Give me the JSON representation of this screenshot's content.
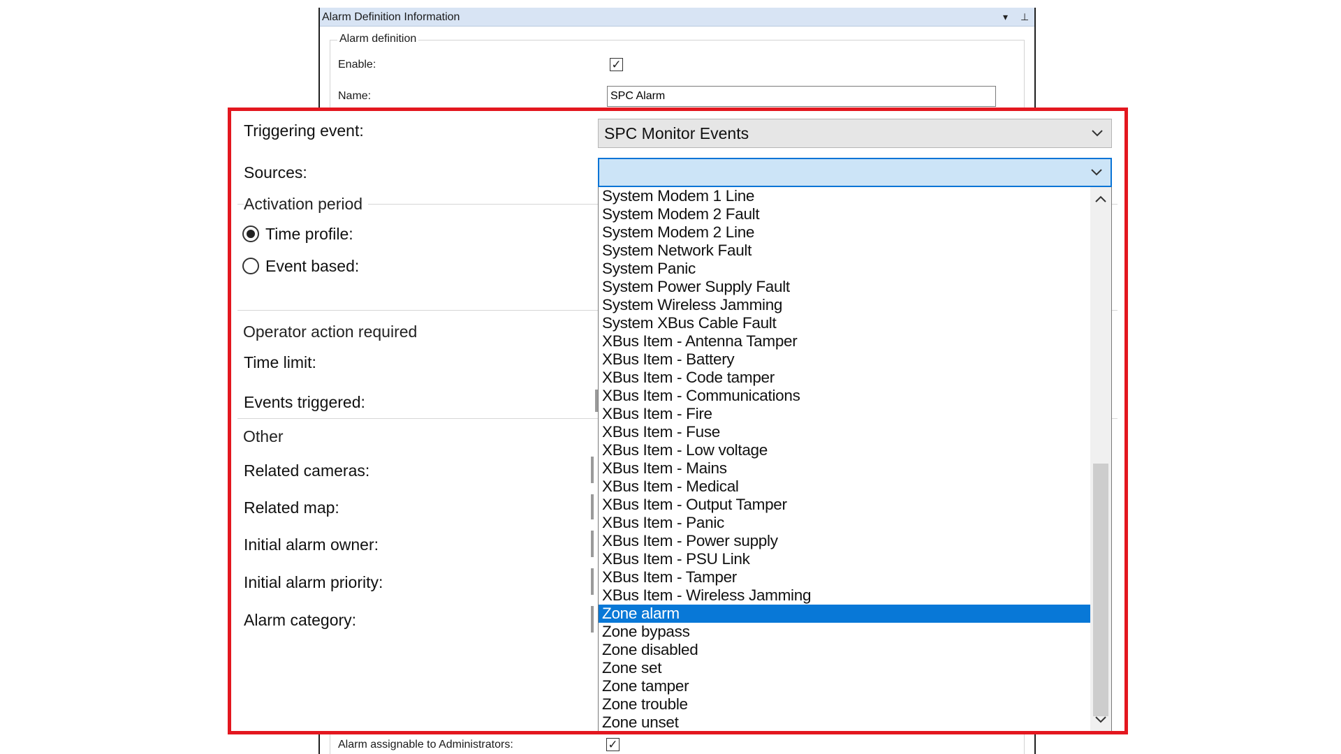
{
  "window": {
    "title": "Alarm Definition Information",
    "dropdown_glyph": "▾",
    "pin_glyph": "⊥"
  },
  "alarm_definition": {
    "group_label": "Alarm definition",
    "enable_label": "Enable:",
    "enable_checked": true,
    "name_label": "Name:",
    "name_value": "SPC Alarm",
    "assignable_label": "Alarm assignable to Administrators:",
    "assignable_checked": true
  },
  "zoomed": {
    "triggering_event_label": "Triggering event:",
    "triggering_event_value": "SPC Monitor Events",
    "sources_label": "Sources:",
    "activation_period": {
      "title": "Activation period",
      "time_profile_label": "Time profile:",
      "time_profile_selected": true,
      "event_based_label": "Event based:",
      "event_based_selected": false
    },
    "operator_action": {
      "title": "Operator action required",
      "time_limit_label": "Time limit:",
      "events_triggered_label": "Events triggered:"
    },
    "other": {
      "title": "Other",
      "related_cameras_label": "Related cameras:",
      "related_map_label": "Related map:",
      "initial_owner_label": "Initial alarm owner:",
      "initial_priority_label": "Initial alarm priority:",
      "category_label": "Alarm category:"
    }
  },
  "event_list": {
    "selected": "Zone alarm",
    "items": [
      "System Modem 1 Line",
      "System Modem 2 Fault",
      "System Modem 2 Line",
      "System Network Fault",
      "System Panic",
      "System Power Supply Fault",
      "System Wireless Jamming",
      "System XBus Cable Fault",
      "XBus Item - Antenna Tamper",
      "XBus Item - Battery",
      "XBus Item - Code tamper",
      "XBus Item - Communications",
      "XBus Item - Fire",
      "XBus Item - Fuse",
      "XBus Item - Low voltage",
      "XBus Item - Mains",
      "XBus Item - Medical",
      "XBus Item - Output Tamper",
      "XBus Item - Panic",
      "XBus Item - Power supply",
      "XBus Item - PSU Link",
      "XBus Item - Tamper",
      "XBus Item - Wireless Jamming",
      "Zone alarm",
      "Zone bypass",
      "Zone disabled",
      "Zone set",
      "Zone tamper",
      "Zone trouble",
      "Zone unset"
    ]
  },
  "colors": {
    "highlight_border": "#e3171f",
    "selected_item_bg": "#0878d7",
    "focused_select_bg": "#cce4f7",
    "title_bar_bg": "#d8e4f4"
  }
}
